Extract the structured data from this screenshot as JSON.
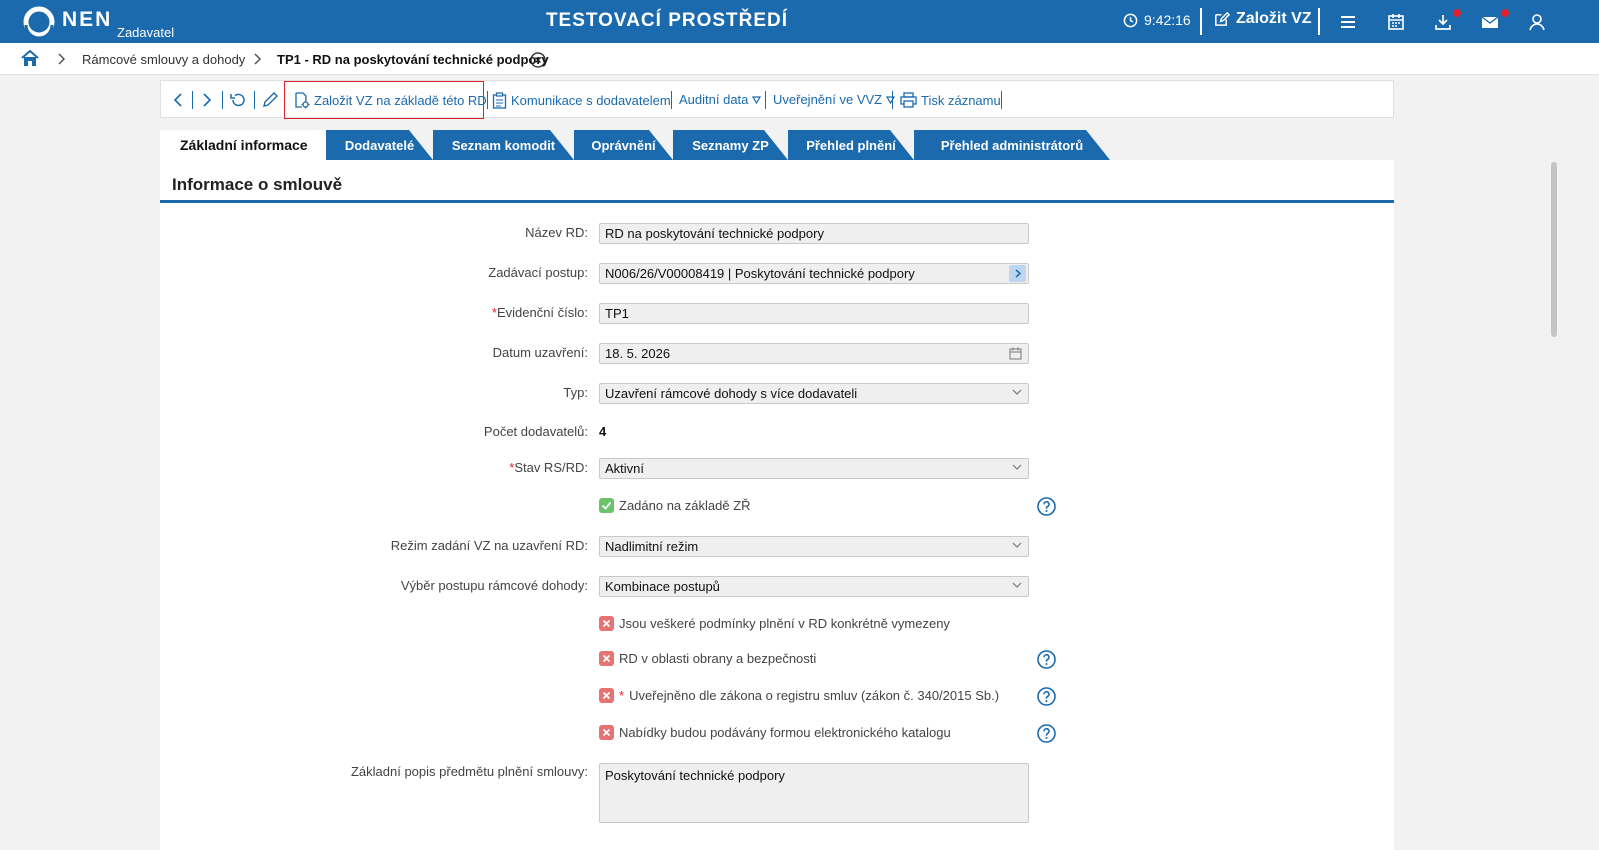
{
  "header": {
    "logo_text": "NEN",
    "logo_subtitle": "Zadavatel",
    "environment_title": "TESTOVACÍ PROSTŘEDÍ",
    "clock": "9:42:16",
    "new_vz_label": "Založit VZ"
  },
  "breadcrumb": {
    "items": [
      "Rámcové smlouvy a dohody",
      "TP1 - RD na poskytování technické podpory"
    ]
  },
  "toolbar": {
    "create_vz": "Založit VZ na základě této RD",
    "communication": "Komunikace s dodavatelem",
    "audit": "Auditní data",
    "publish": "Uveřejnění ve VVZ",
    "print": "Tisk záznamu"
  },
  "tabs": {
    "active": "Základní informace",
    "items": [
      "Dodavatelé",
      "Seznam komodit",
      "Oprávnění",
      "Seznamy ZP",
      "Přehled plnění",
      "Přehled administrátorů"
    ]
  },
  "section": {
    "title": "Informace o smlouvě"
  },
  "form": {
    "name_label": "Název RD:",
    "name_value": "RD na poskytování technické podpory",
    "procedure_label": "Zadávací postup:",
    "procedure_value": "N006/26/V00008419 | Poskytování technické podpory",
    "evid_label": "Evidenční číslo:",
    "evid_value": "TP1",
    "date_label": "Datum uzavření:",
    "date_value": "18. 5. 2026",
    "type_label": "Typ:",
    "type_value": "Uzavření rámcové dohody s více dodavateli",
    "suppliers_label": "Počet dodavatelů:",
    "suppliers_value": "4",
    "state_label": "Stav RS/RD:",
    "state_value": "Aktivní",
    "zr_check": "Zadáno na základě ZŘ",
    "regime_label": "Režim zadání VZ na uzavření RD:",
    "regime_value": "Nadlimitní režim",
    "selection_label": "Výběr postupu rámcové dohody:",
    "selection_value": "Kombinace postupů",
    "check_conditions": "Jsou veškeré podmínky plnění v RD konkrétně vymezeny",
    "check_defense": "RD v oblasti obrany a bezpečnosti",
    "check_registry": "Uveřejněno dle zákona o registru smluv (zákon č. 340/2015 Sb.)",
    "check_catalog": "Nabídky budou podávány formou elektronického katalogu",
    "description_label": "Základní popis předmětu plnění smlouvy:",
    "description_value": "Poskytování technické podpory"
  },
  "colors": {
    "brand": "#1b6aae",
    "required": "#e0202a",
    "check_ok": "#6cc36c",
    "check_no": "#e57373"
  }
}
